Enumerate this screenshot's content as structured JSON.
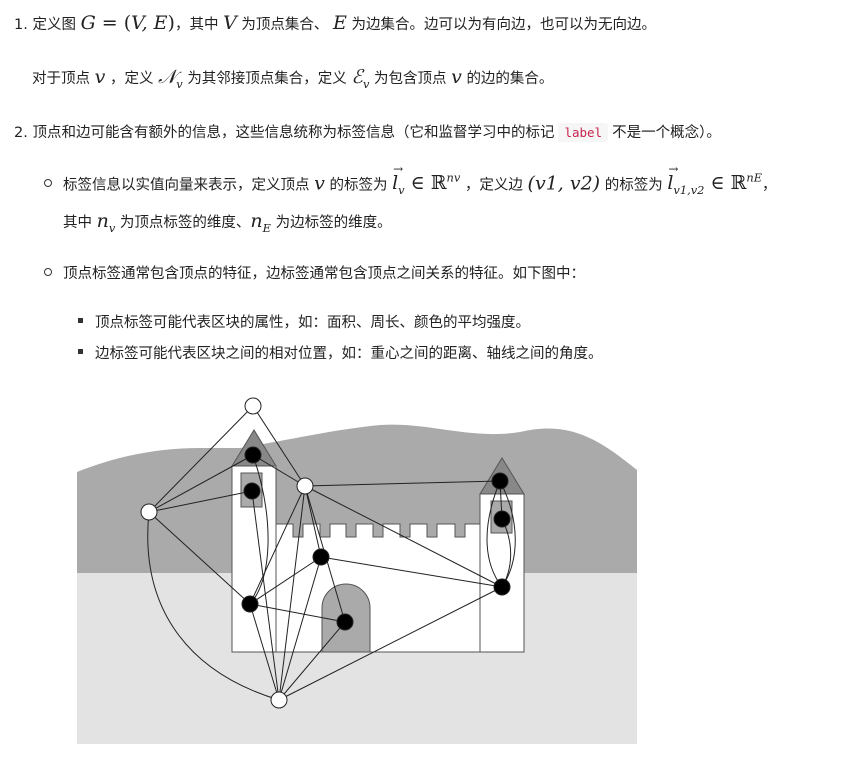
{
  "list": {
    "item1": {
      "number": "1.",
      "t1": "定义图",
      "t2": "，其中",
      "t3": "为顶点集合、",
      "t4": "为边集合。边可以为有向边，也可以为无向边。"
    },
    "item1_sub": {
      "t1": "对于顶点",
      "t2": "，定义",
      "t3": "为其邻接顶点集合，定义",
      "t4": "为包含顶点",
      "t5": "的边的集合。"
    },
    "item2": {
      "number": "2.",
      "t1": "顶点和边可能含有额外的信息，这些信息统称为标签信息（它和监督学习中的标记",
      "code": "label",
      "t2": "不是一个概念）。"
    },
    "bullet1": {
      "t1": "标签信息以实值向量来表示，定义顶点",
      "t2": "的标签为",
      "t3": "，定义边",
      "t4": "的标签为",
      "t5": "，",
      "l2_t1": "其中",
      "l2_t2": "为顶点标签的维度、",
      "l2_t3": "为边标签的维度。"
    },
    "bullet2": {
      "text": "顶点标签通常包含顶点的特征，边标签通常包含顶点之间关系的特征。如下图中："
    },
    "sub_bullets": [
      "顶点标签可能代表区块的属性，如：面积、周长、颜色的平均强度。",
      "边标签可能代表区块之间的相对位置，如：重心之间的距离、轴线之间的角度。"
    ]
  },
  "math": {
    "G": "G = (V, E)",
    "V": "V",
    "E": "E",
    "v": "v",
    "Nv": "𝒩",
    "Ev": "ℰ",
    "sub_v": "v",
    "lv": "l",
    "R": "ℝ",
    "nv_sup": "nv",
    "edge": "(v1, v2)",
    "nE_sup": "nE",
    "nv": "n",
    "nE": "n",
    "sub_E": "E",
    "sub_v1v2": "v1,v2"
  },
  "colors": {
    "text": "#222222",
    "code": "#c7254e",
    "sky_gray": "#aaaaaa",
    "ground_gray": "#e3e3e3",
    "roof_gray": "#888888"
  }
}
